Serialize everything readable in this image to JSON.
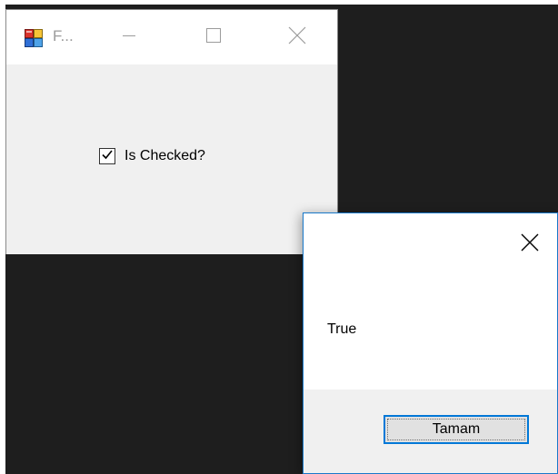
{
  "form": {
    "title": "F...",
    "checkbox": {
      "label": "Is Checked?",
      "checked": true
    }
  },
  "message_box": {
    "text": "True",
    "ok_label": "Tamam"
  },
  "icons": {
    "app": "windows-form-app-icon",
    "minimize": "minimize-icon",
    "maximize": "maximize-icon",
    "close": "close-icon",
    "check": "check-icon"
  },
  "colors": {
    "desktop": "#1e1e1e",
    "window_face": "#f0f0f0",
    "title_bar": "#ffffff",
    "dialog_border": "#1979ca",
    "focus_border": "#0078d7",
    "title_text_inactive": "#9b9b9b"
  }
}
